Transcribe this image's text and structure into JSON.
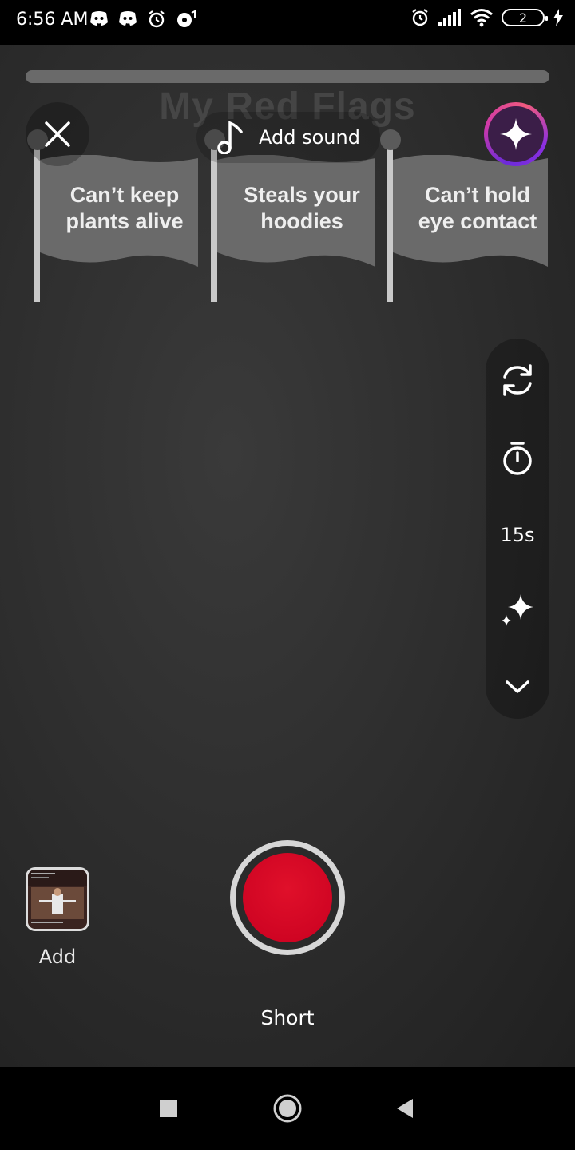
{
  "status_bar": {
    "time": "6:56 AM",
    "battery_level": "2"
  },
  "sticker": {
    "title": "My Red Flags",
    "flags": [
      {
        "line1": "Can’t keep",
        "line2": "plants alive"
      },
      {
        "line1": "Steals your",
        "line2": "hoodies"
      },
      {
        "line1": "Can’t hold",
        "line2": "eye contact"
      }
    ]
  },
  "top_bar": {
    "add_sound_label": "Add sound"
  },
  "side_rail": {
    "duration_label": "15s"
  },
  "bottom": {
    "add_label": "Add",
    "mode_label": "Short"
  },
  "colors": {
    "record": "#d3001f",
    "effects_gradient": "#d23aa7"
  },
  "icons": [
    "close-icon",
    "music-note-icon",
    "sparkle-icon",
    "flip-camera-icon",
    "timer-icon",
    "effects-icon",
    "chevron-down-icon"
  ]
}
